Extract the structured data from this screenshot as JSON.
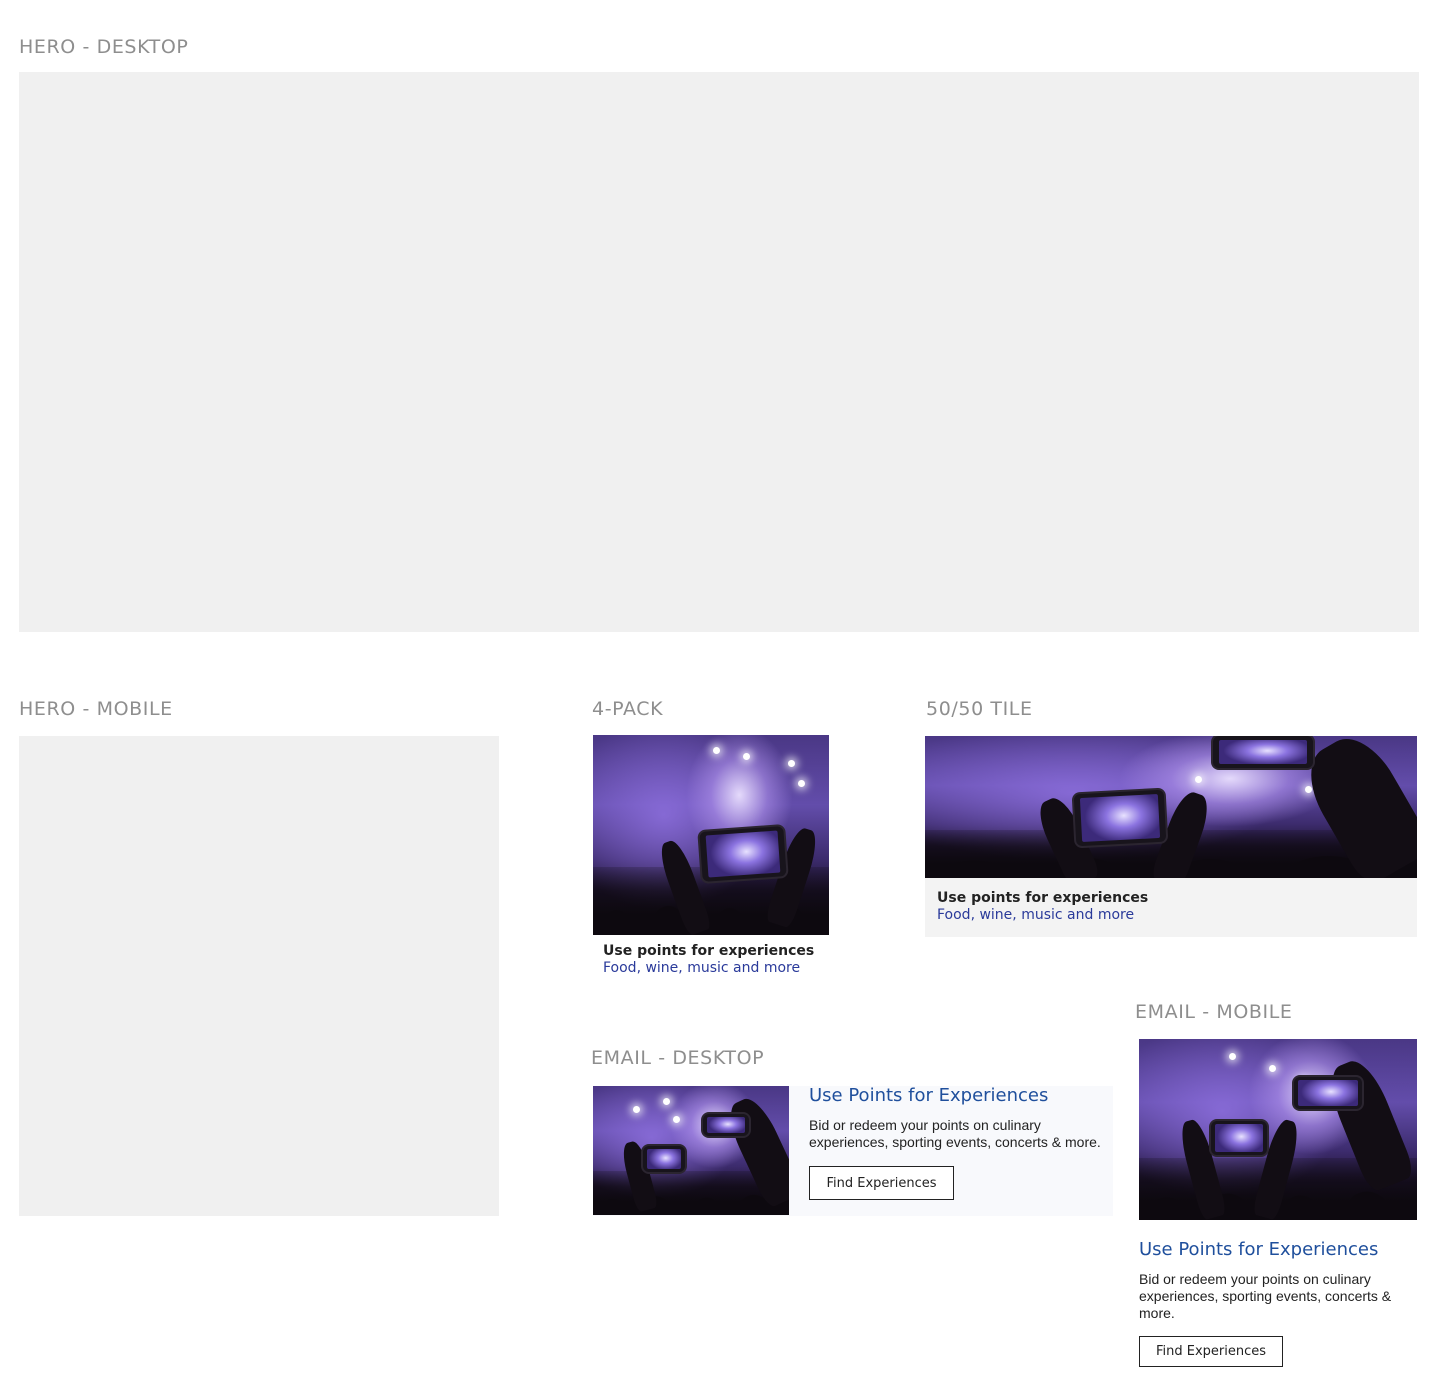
{
  "sections": {
    "hero_desktop": "HERO - DESKTOP",
    "hero_mobile": "HERO - MOBILE",
    "four_pack": "4-PACK",
    "fifty_tile": "50/50 TILE",
    "email_desktop": "EMAIL - DESKTOP",
    "email_mobile": "EMAIL - MOBILE"
  },
  "four_pack": {
    "title": "Use points for experiences",
    "subtitle": "Food, wine, music and more"
  },
  "fifty_tile": {
    "title": "Use points for experiences",
    "subtitle": "Food, wine, music and more"
  },
  "email_desktop": {
    "title": "Use Points for Experiences",
    "body": "Bid or redeem your points on culinary experiences, sporting events, concerts & more.",
    "button": "Find Experiences"
  },
  "email_mobile": {
    "title": "Use Points for Experiences",
    "body": "Bid or redeem your points on culinary experiences, sporting events, concerts & more.",
    "button": "Find Experiences"
  },
  "colors": {
    "placeholder": "#f0f0f0",
    "section_label": "#8e8e8e",
    "subtitle_link": "#2a3a9a",
    "email_title": "#1f4f9c"
  }
}
